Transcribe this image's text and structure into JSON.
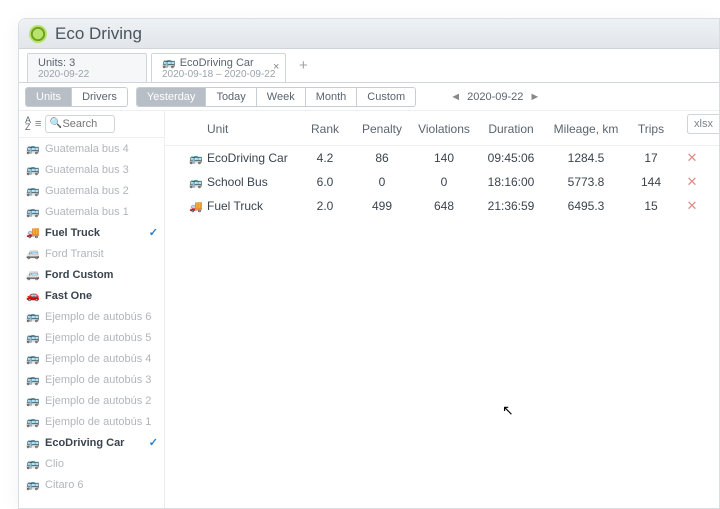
{
  "app": {
    "title": "Eco Driving"
  },
  "tabs": [
    {
      "line1": "Units: 3",
      "line2": "2020-09-22",
      "active": true
    },
    {
      "line1": "EcoDriving Car",
      "line2": "2020-09-18 – 2020-09-22",
      "icon": true,
      "closable": true
    }
  ],
  "view_toggle": {
    "units": "Units",
    "drivers": "Drivers",
    "selected": "Units"
  },
  "range_buttons": [
    "Yesterday",
    "Today",
    "Week",
    "Month",
    "Custom"
  ],
  "range_selected": "Yesterday",
  "date_nav": "2020-09-22",
  "export_label": "xlsx",
  "search_placeholder": "Search",
  "sidebar_units": [
    {
      "name": "Guatemala bus 4",
      "icon": "bus-red",
      "disabled": true
    },
    {
      "name": "Guatemala bus 3",
      "icon": "bus-red",
      "disabled": true
    },
    {
      "name": "Guatemala bus 2",
      "icon": "bus-red",
      "disabled": true
    },
    {
      "name": "Guatemala bus 1",
      "icon": "bus-red",
      "disabled": true
    },
    {
      "name": "Fuel Truck",
      "icon": "truck",
      "checked": true,
      "strong": true
    },
    {
      "name": "Ford Transit",
      "icon": "van",
      "disabled": true
    },
    {
      "name": "Ford Custom",
      "icon": "van2",
      "strong": true
    },
    {
      "name": "Fast One",
      "icon": "car",
      "strong": true
    },
    {
      "name": "Ejemplo de autobús 6",
      "icon": "bus-red",
      "disabled": true
    },
    {
      "name": "Ejemplo de autobús 5",
      "icon": "bus-red",
      "disabled": true
    },
    {
      "name": "Ejemplo de autobús 4",
      "icon": "bus-red",
      "disabled": true
    },
    {
      "name": "Ejemplo de autobús 3",
      "icon": "bus-red",
      "disabled": true
    },
    {
      "name": "Ejemplo de autobús 2",
      "icon": "bus-red",
      "disabled": true
    },
    {
      "name": "Ejemplo de autobús 1",
      "icon": "bus-red",
      "disabled": true
    },
    {
      "name": "EcoDriving Car",
      "icon": "bus-red",
      "checked": true,
      "strong": true
    },
    {
      "name": "Clio",
      "icon": "bus-red",
      "disabled": true
    },
    {
      "name": "Citaro 6",
      "icon": "bus-red",
      "disabled": true
    }
  ],
  "columns": {
    "unit": "Unit",
    "rank": "Rank",
    "penalty": "Penalty",
    "violations": "Violations",
    "duration": "Duration",
    "mileage": "Mileage, km",
    "trips": "Trips"
  },
  "rows": [
    {
      "icon": "bus-red",
      "unit": "EcoDriving Car",
      "rank": "4.2",
      "penalty": "86",
      "violations": "140",
      "duration": "09:45:06",
      "mileage": "1284.5",
      "trips": "17"
    },
    {
      "icon": "schoolbus",
      "unit": "School Bus",
      "rank": "6.0",
      "penalty": "0",
      "violations": "0",
      "duration": "18:16:00",
      "mileage": "5773.8",
      "trips": "144"
    },
    {
      "icon": "truck",
      "unit": "Fuel Truck",
      "rank": "2.0",
      "penalty": "499",
      "violations": "648",
      "duration": "21:36:59",
      "mileage": "6495.3",
      "trips": "15"
    }
  ]
}
